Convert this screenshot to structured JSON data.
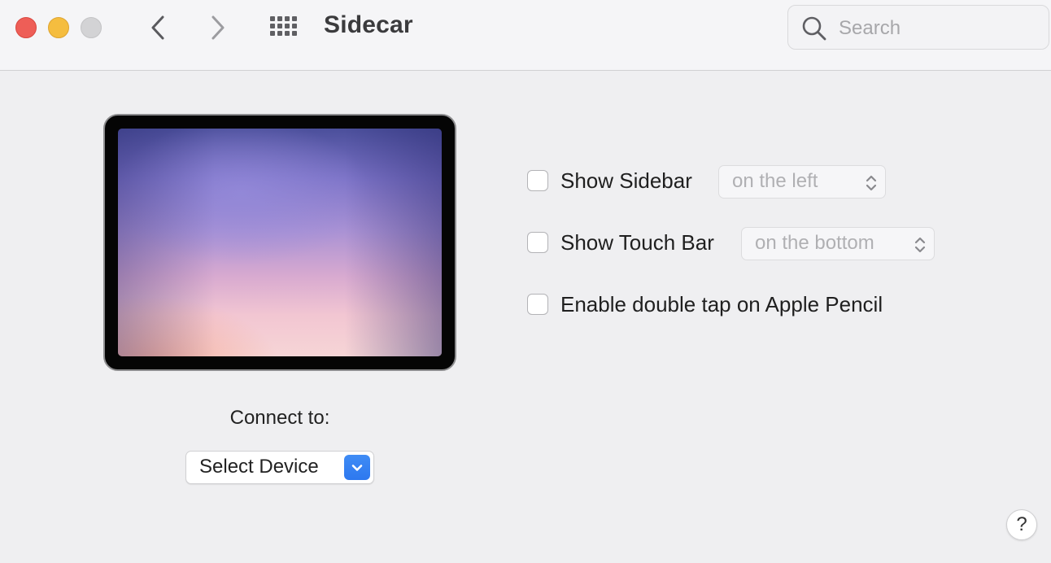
{
  "window": {
    "title": "Sidecar",
    "controls": {
      "close": "#ee5e57",
      "minimize": "#f5bd3f",
      "zoom": "#d3d3d5"
    }
  },
  "toolbar": {
    "back_icon": "chevron-left-icon",
    "forward_icon": "chevron-right-icon",
    "show_all_icon": "grid-icon",
    "search": {
      "placeholder": "Search",
      "value": "",
      "icon": "search-icon"
    }
  },
  "device_preview": {
    "icon": "ipad-icon"
  },
  "connect": {
    "label": "Connect to:",
    "select_value": "Select Device",
    "accent": "#2f7cf0"
  },
  "options": [
    {
      "label": "Show Sidebar",
      "checked": false,
      "popup_value": "on the left"
    },
    {
      "label": "Show Touch Bar",
      "checked": false,
      "popup_value": "on the bottom"
    },
    {
      "label": "Enable double tap on Apple Pencil",
      "checked": false
    }
  ],
  "help": {
    "label": "?"
  }
}
